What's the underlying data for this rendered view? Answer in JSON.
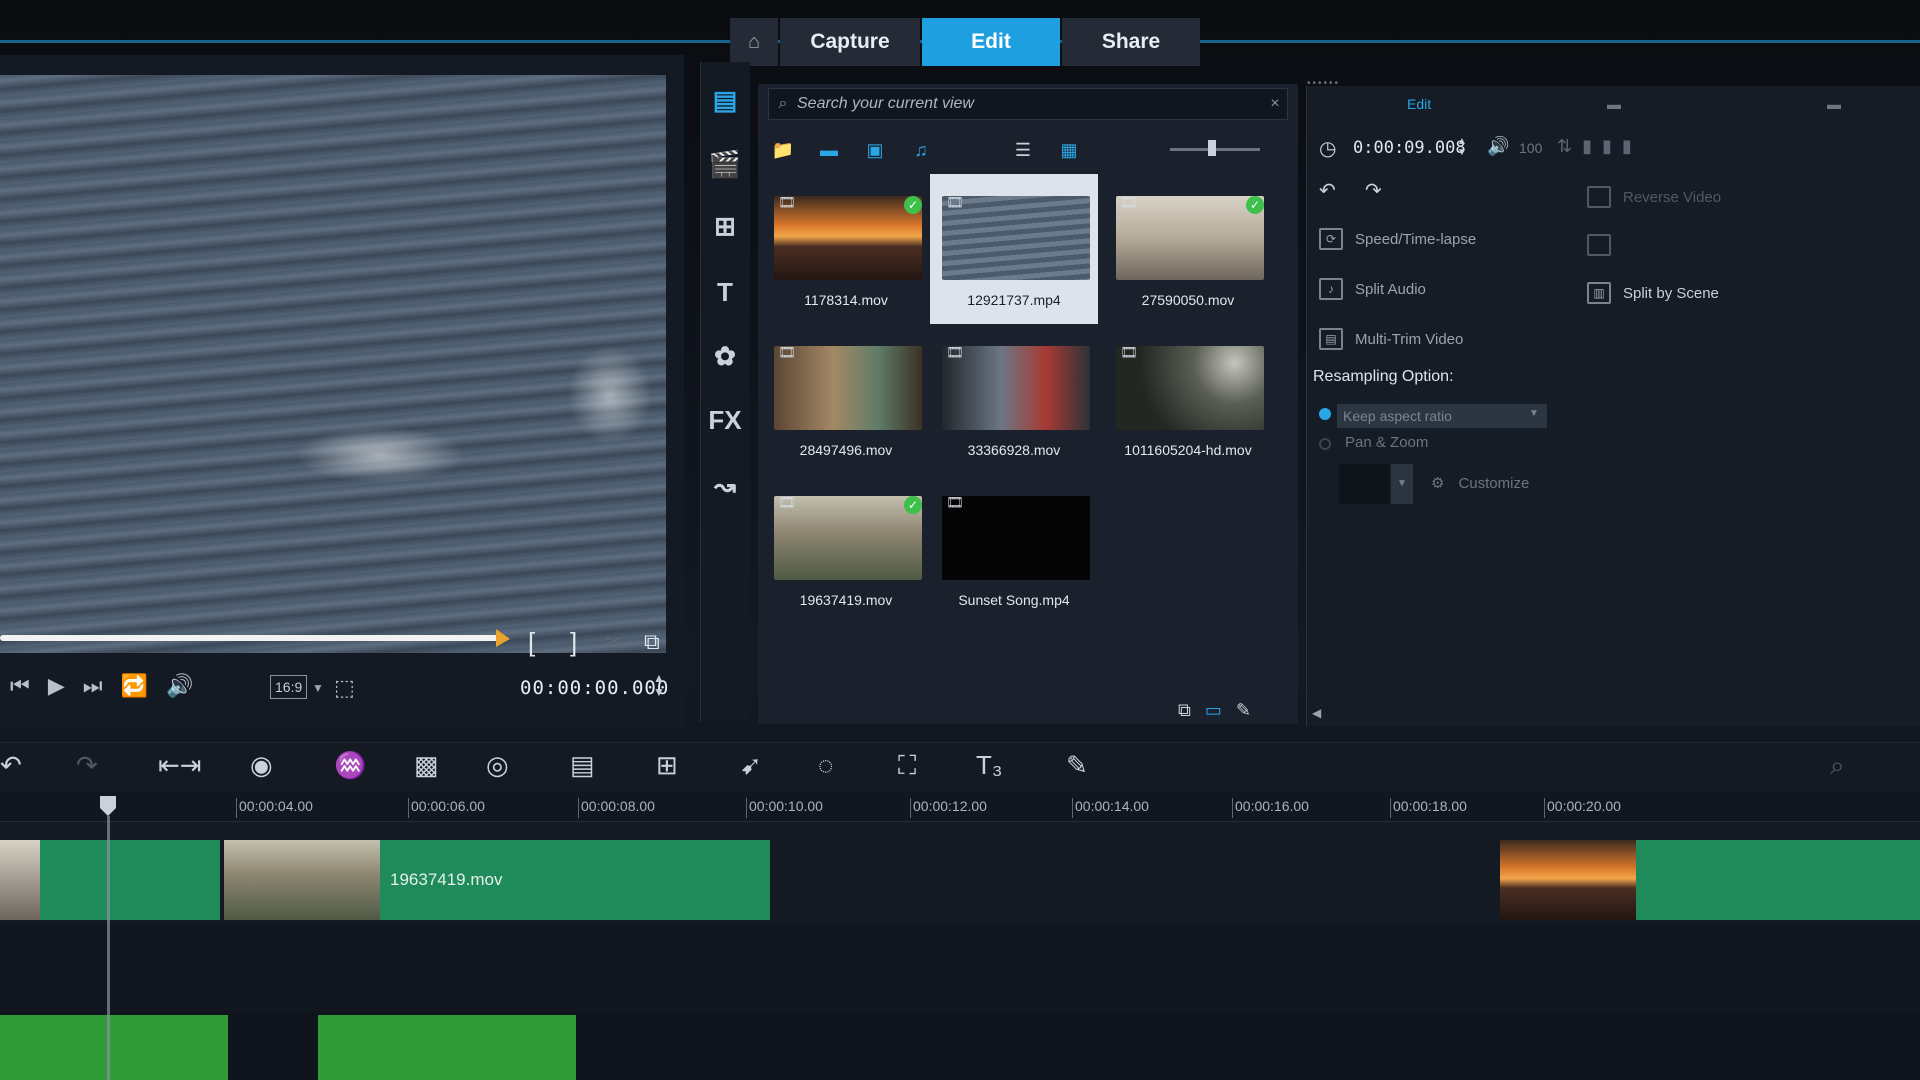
{
  "app": {
    "tabs": {
      "home_icon": "home-icon",
      "capture": "Capture",
      "edit": "Edit",
      "share": "Share"
    }
  },
  "preview": {
    "aspect": "16:9",
    "timecode": "00:00:00.000",
    "scrub_progress": 0.76
  },
  "library": {
    "search_placeholder": "Search your current view",
    "items": [
      {
        "name": "1178314.mov",
        "checked": true,
        "selected": false
      },
      {
        "name": "12921737.mp4",
        "checked": false,
        "selected": true
      },
      {
        "name": "27590050.mov",
        "checked": true,
        "selected": false
      },
      {
        "name": "28497496.mov",
        "checked": false,
        "selected": false
      },
      {
        "name": "33366928.mov",
        "checked": false,
        "selected": false
      },
      {
        "name": "1011605204-hd.mov",
        "checked": false,
        "selected": false
      },
      {
        "name": "19637419.mov",
        "checked": true,
        "selected": false
      },
      {
        "name": "Sunset Song.mp4",
        "checked": false,
        "selected": false
      }
    ]
  },
  "options": {
    "tab_edit": "Edit",
    "duration": "0:00:09.008",
    "volume": "100",
    "speed_timelapse": "Speed/Time-lapse",
    "split_audio": "Split Audio",
    "multi_trim": "Multi-Trim Video",
    "split_by_scene": "Split by Scene",
    "reverse_video": "Reverse Video",
    "resampling_label": "Resampling Option:",
    "resampling_value": "Keep aspect ratio",
    "pan_zoom": "Pan & Zoom",
    "customize": "Customize"
  },
  "timeline": {
    "ticks": [
      "00:00:04.00",
      "00:00:06.00",
      "00:00:08.00",
      "00:00:10.00",
      "00:00:12.00",
      "00:00:14.00",
      "00:00:16.00",
      "00:00:18.00",
      "00:00:20.00"
    ],
    "clip_main": "19637419.mov"
  },
  "colors": {
    "accent": "#1ea0e0",
    "clip_green": "#1f8a5a",
    "check_green": "#3fbf4c",
    "audio_green": "#2f9c37"
  }
}
